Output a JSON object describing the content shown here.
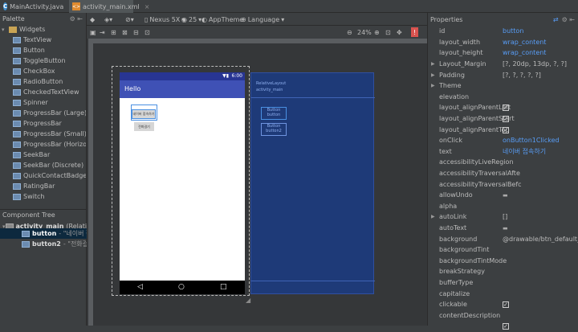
{
  "tabs": [
    {
      "label": "MainActivity.java",
      "icon": "java-class-icon"
    },
    {
      "label": "activity_main.xml",
      "icon": "xml-file-icon"
    }
  ],
  "palette": {
    "title": "Palette",
    "section": "Widgets",
    "items": [
      "TextView",
      "Button",
      "ToggleButton",
      "CheckBox",
      "RadioButton",
      "CheckedTextView",
      "Spinner",
      "ProgressBar (Large)",
      "ProgressBar",
      "ProgressBar (Small)",
      "ProgressBar (Horizontal)",
      "SeekBar",
      "SeekBar (Discrete)",
      "QuickContactBadge",
      "RatingBar",
      "Switch"
    ]
  },
  "component_tree": {
    "title": "Component Tree",
    "root": "activity_main",
    "root_type": "(RelativeL",
    "children": [
      {
        "name": "button",
        "text": "- \"네이버 접"
      },
      {
        "name": "button2",
        "text": "- \"전화걸기\""
      }
    ]
  },
  "toolbar": {
    "device": "Nexus 5X",
    "api": "25",
    "theme": "AppTheme",
    "language": "Language",
    "zoom": "24%"
  },
  "phone": {
    "status_time": "6:00",
    "app_title": "Hello",
    "btn1": "네이버 접속하기",
    "btn2": "전화걸기"
  },
  "blueprint": {
    "layout_label": "RelativeLayout",
    "layout_id": "activity_main",
    "btn1_label": "Button",
    "btn1_id": "button",
    "btn2_label": "Button",
    "btn2_id": "button2"
  },
  "properties": {
    "title": "Properties",
    "rows": [
      {
        "k": "id",
        "v": "button",
        "type": "blue"
      },
      {
        "k": "layout_width",
        "v": "wrap_content",
        "type": "blue"
      },
      {
        "k": "layout_height",
        "v": "wrap_content",
        "type": "blue"
      },
      {
        "k": "Layout_Margin",
        "v": "[?, 20dp, 13dp, ?, ?]",
        "type": "text",
        "exp": true
      },
      {
        "k": "Padding",
        "v": "[?, ?, ?, ?, ?]",
        "type": "text",
        "exp": true
      },
      {
        "k": "Theme",
        "v": "",
        "type": "text",
        "exp": true
      },
      {
        "k": "elevation",
        "v": "",
        "type": "text"
      },
      {
        "k": "layout_alignParentLeft",
        "v": "",
        "type": "check"
      },
      {
        "k": "layout_alignParentStart",
        "v": "",
        "type": "check"
      },
      {
        "k": "layout_alignParentTop",
        "v": "",
        "type": "check"
      },
      {
        "k": "onClick",
        "v": "onButton1Clicked",
        "type": "blue"
      },
      {
        "k": "text",
        "v": "네이버 접속하기",
        "type": "blue"
      },
      {
        "k": "accessibilityLiveRegion",
        "v": "",
        "type": "text"
      },
      {
        "k": "accessibilityTraversalAfte",
        "v": "",
        "type": "text"
      },
      {
        "k": "accessibilityTraversalBefc",
        "v": "",
        "type": "text"
      },
      {
        "k": "allowUndo",
        "v": "",
        "type": "dd"
      },
      {
        "k": "alpha",
        "v": "",
        "type": "text"
      },
      {
        "k": "autoLink",
        "v": "[]",
        "type": "text",
        "exp": true
      },
      {
        "k": "autoText",
        "v": "",
        "type": "dd"
      },
      {
        "k": "background",
        "v": "@drawable/btn_default_ma",
        "type": "text"
      },
      {
        "k": "backgroundTint",
        "v": "",
        "type": "text"
      },
      {
        "k": "backgroundTintMode",
        "v": "",
        "type": "text"
      },
      {
        "k": "breakStrategy",
        "v": "",
        "type": "text"
      },
      {
        "k": "bufferType",
        "v": "",
        "type": "text"
      },
      {
        "k": "capitalize",
        "v": "",
        "type": "text"
      },
      {
        "k": "clickable",
        "v": "",
        "type": "check"
      },
      {
        "k": "contentDescription",
        "v": "",
        "type": "text"
      },
      {
        "k": "",
        "v": "",
        "type": "check"
      }
    ]
  }
}
